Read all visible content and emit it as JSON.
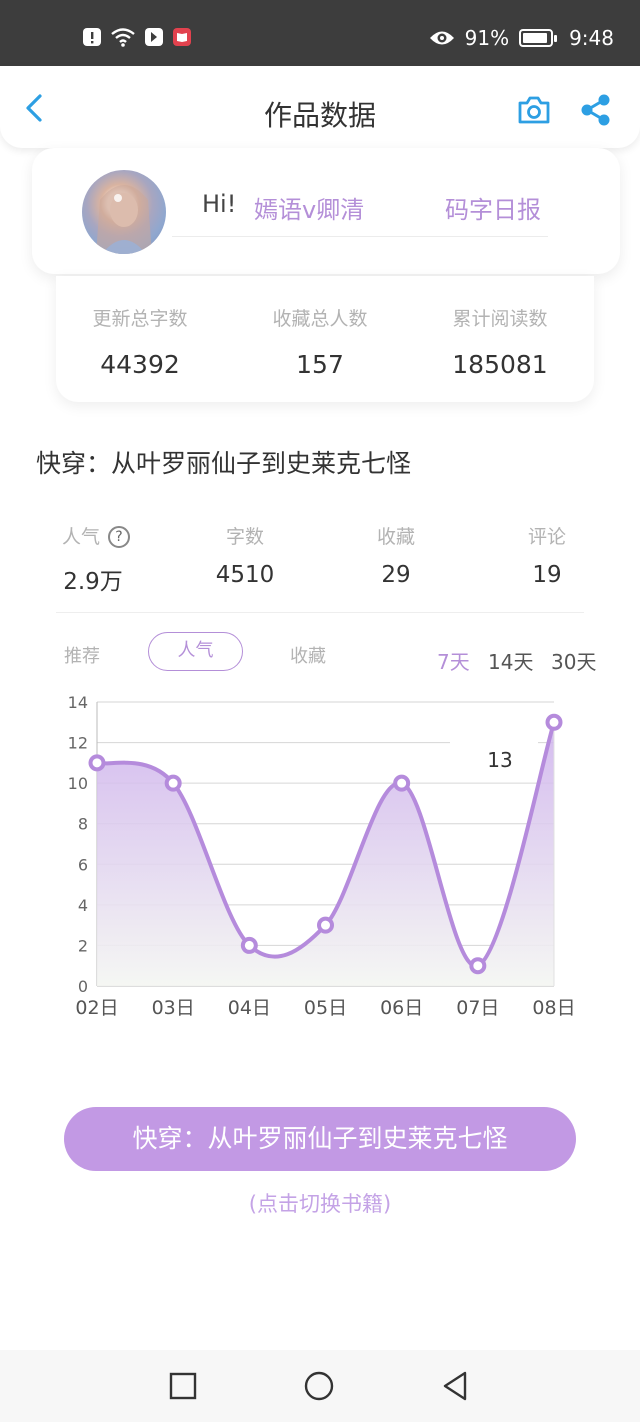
{
  "status_bar": {
    "battery_percent": "91%",
    "battery_level": 0.91,
    "time": "9:48",
    "icons": [
      "alert-icon",
      "wifi-icon",
      "app-icon",
      "book-app-icon",
      "eye-icon",
      "battery-icon"
    ]
  },
  "nav": {
    "title": "作品数据",
    "back_icon": "chevron-left-icon",
    "camera_icon": "camera-icon",
    "share_icon": "share-icon",
    "accent_color": "#2d9fe3"
  },
  "profile": {
    "greeting": "Hi!",
    "username": "嫣语v卿清",
    "daily_report_label": "码字日报"
  },
  "totals": [
    {
      "label": "更新总字数",
      "value": "44392"
    },
    {
      "label": "收藏总人数",
      "value": "157"
    },
    {
      "label": "累计阅读数",
      "value": "185081"
    }
  ],
  "book": {
    "title": "快穿：从叶罗丽仙子到史莱克七怪",
    "stats": [
      {
        "label": "人气",
        "value": "2.9万"
      },
      {
        "label": "字数",
        "value": "4510"
      },
      {
        "label": "收藏",
        "value": "29"
      },
      {
        "label": "评论",
        "value": "19"
      }
    ]
  },
  "tabs": {
    "items": [
      "推荐",
      "人气",
      "收藏"
    ],
    "active": "人气"
  },
  "ranges": {
    "items": [
      "7天",
      "14天",
      "30天"
    ],
    "active": "7天"
  },
  "chart_data": {
    "type": "area",
    "categories": [
      "02日",
      "03日",
      "04日",
      "05日",
      "06日",
      "07日",
      "08日"
    ],
    "values": [
      11,
      10,
      2,
      3,
      10,
      1,
      13
    ],
    "ylim": [
      0,
      14
    ],
    "yticks": [
      0,
      2,
      4,
      6,
      8,
      10,
      12,
      14
    ],
    "grid": true,
    "tooltip_value": "13",
    "line_color": "#b58bdc"
  },
  "switch_button": {
    "label": "快穿：从叶罗丽仙子到史莱克七怪",
    "hint": "(点击切换书籍)",
    "color": "#c299e4"
  },
  "system_nav": {
    "icons": [
      "square-icon",
      "circle-icon",
      "triangle-back-icon"
    ]
  }
}
